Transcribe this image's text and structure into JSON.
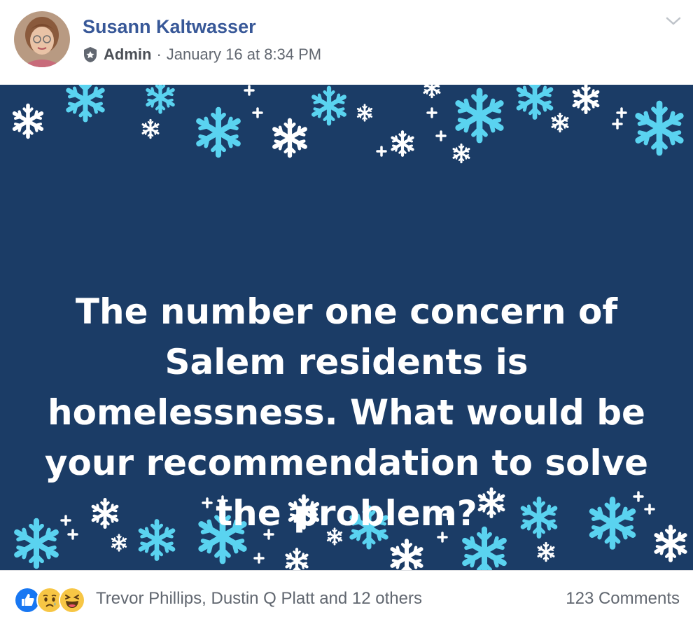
{
  "post": {
    "author": "Susann Kaltwasser",
    "role": "Admin",
    "separator": "·",
    "timestamp": "January 16 at 8:34 PM",
    "image_text": "The number one concern of Salem residents is homelessness. What would be your recommendation to solve the problem?"
  },
  "footer": {
    "reaction_icons": [
      "like-icon",
      "sad-icon",
      "haha-icon"
    ],
    "reactors": "Trevor Phillips, Dustin Q Platt and 12 others",
    "comments": "123 Comments"
  },
  "colors": {
    "author": "#385898",
    "card_background": "#1b3c66",
    "snow_light": "#5ad3f0",
    "snow_white": "#ffffff",
    "like_blue": "#1877f2",
    "emoji_yellow": "#f7c645"
  }
}
